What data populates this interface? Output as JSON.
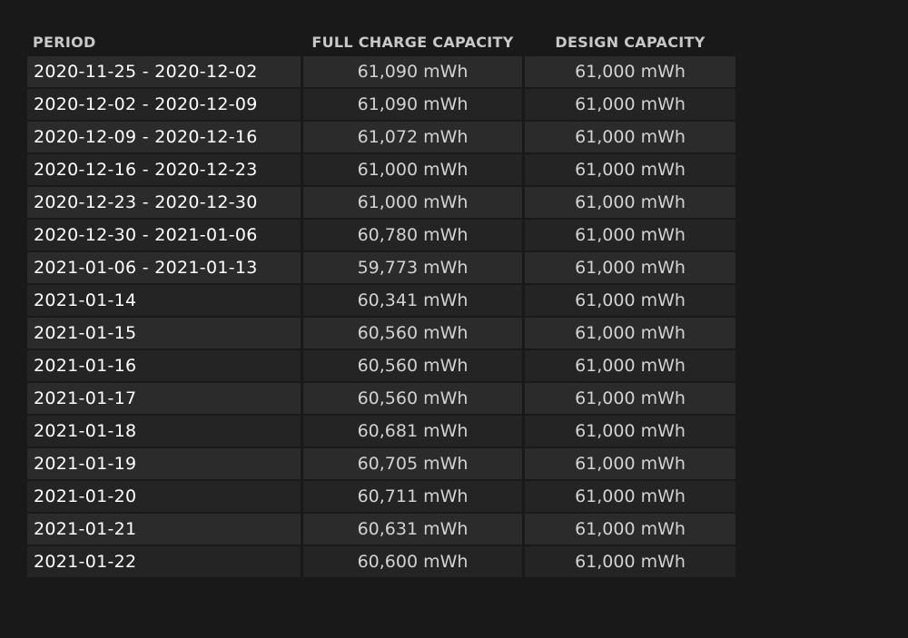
{
  "table": {
    "headers": {
      "period": "PERIOD",
      "full_charge": "FULL CHARGE CAPACITY",
      "design": "DESIGN CAPACITY"
    },
    "rows": [
      {
        "period": "2020-11-25 - 2020-12-02",
        "full_charge": "61,090 mWh",
        "design": "61,000 mWh"
      },
      {
        "period": "2020-12-02 - 2020-12-09",
        "full_charge": "61,090 mWh",
        "design": "61,000 mWh"
      },
      {
        "period": "2020-12-09 - 2020-12-16",
        "full_charge": "61,072 mWh",
        "design": "61,000 mWh"
      },
      {
        "period": "2020-12-16 - 2020-12-23",
        "full_charge": "61,000 mWh",
        "design": "61,000 mWh"
      },
      {
        "period": "2020-12-23 - 2020-12-30",
        "full_charge": "61,000 mWh",
        "design": "61,000 mWh"
      },
      {
        "period": "2020-12-30 - 2021-01-06",
        "full_charge": "60,780 mWh",
        "design": "61,000 mWh"
      },
      {
        "period": "2021-01-06 - 2021-01-13",
        "full_charge": "59,773 mWh",
        "design": "61,000 mWh"
      },
      {
        "period": "2021-01-14",
        "full_charge": "60,341 mWh",
        "design": "61,000 mWh"
      },
      {
        "period": "2021-01-15",
        "full_charge": "60,560 mWh",
        "design": "61,000 mWh"
      },
      {
        "period": "2021-01-16",
        "full_charge": "60,560 mWh",
        "design": "61,000 mWh"
      },
      {
        "period": "2021-01-17",
        "full_charge": "60,560 mWh",
        "design": "61,000 mWh"
      },
      {
        "period": "2021-01-18",
        "full_charge": "60,681 mWh",
        "design": "61,000 mWh"
      },
      {
        "period": "2021-01-19",
        "full_charge": "60,705 mWh",
        "design": "61,000 mWh"
      },
      {
        "period": "2021-01-20",
        "full_charge": "60,711 mWh",
        "design": "61,000 mWh"
      },
      {
        "period": "2021-01-21",
        "full_charge": "60,631 mWh",
        "design": "61,000 mWh"
      },
      {
        "period": "2021-01-22",
        "full_charge": "60,600 mWh",
        "design": "61,000 mWh"
      }
    ]
  },
  "colors": {
    "background": "#191919",
    "row_odd": "#2b2b2b",
    "row_even": "#242424",
    "header_text": "#c8c8c8",
    "period_text": "#ffffff",
    "value_text": "#d2d2d2"
  }
}
